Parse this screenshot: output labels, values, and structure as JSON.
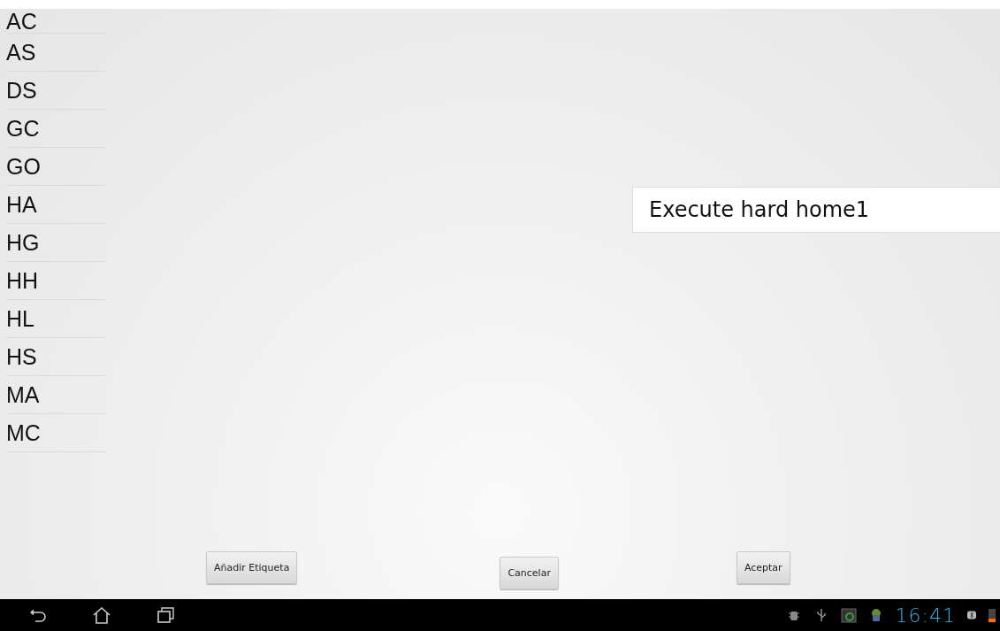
{
  "tag_list": {
    "items": [
      {
        "label": "AC"
      },
      {
        "label": "AS"
      },
      {
        "label": "DS"
      },
      {
        "label": "GC"
      },
      {
        "label": "GO"
      },
      {
        "label": "HA"
      },
      {
        "label": "HG"
      },
      {
        "label": "HH"
      },
      {
        "label": "HL"
      },
      {
        "label": "HS"
      },
      {
        "label": "MA"
      },
      {
        "label": "MC"
      }
    ]
  },
  "command_field": {
    "value": "Execute hard home1"
  },
  "buttons": [
    {
      "label": "Añadir Etiqueta"
    },
    {
      "label": "Cancelar"
    },
    {
      "label": "Aceptar"
    }
  ],
  "status_bar": {
    "time": "16:41"
  }
}
